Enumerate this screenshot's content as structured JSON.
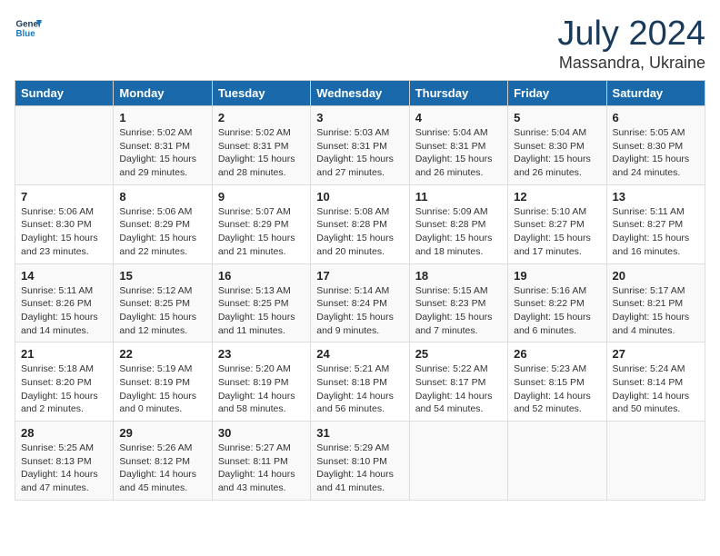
{
  "logo": {
    "line1": "General",
    "line2": "Blue"
  },
  "title": "July 2024",
  "location": "Massandra, Ukraine",
  "days_of_week": [
    "Sunday",
    "Monday",
    "Tuesday",
    "Wednesday",
    "Thursday",
    "Friday",
    "Saturday"
  ],
  "weeks": [
    [
      {
        "num": "",
        "info": ""
      },
      {
        "num": "1",
        "info": "Sunrise: 5:02 AM\nSunset: 8:31 PM\nDaylight: 15 hours\nand 29 minutes."
      },
      {
        "num": "2",
        "info": "Sunrise: 5:02 AM\nSunset: 8:31 PM\nDaylight: 15 hours\nand 28 minutes."
      },
      {
        "num": "3",
        "info": "Sunrise: 5:03 AM\nSunset: 8:31 PM\nDaylight: 15 hours\nand 27 minutes."
      },
      {
        "num": "4",
        "info": "Sunrise: 5:04 AM\nSunset: 8:31 PM\nDaylight: 15 hours\nand 26 minutes."
      },
      {
        "num": "5",
        "info": "Sunrise: 5:04 AM\nSunset: 8:30 PM\nDaylight: 15 hours\nand 26 minutes."
      },
      {
        "num": "6",
        "info": "Sunrise: 5:05 AM\nSunset: 8:30 PM\nDaylight: 15 hours\nand 24 minutes."
      }
    ],
    [
      {
        "num": "7",
        "info": "Sunrise: 5:06 AM\nSunset: 8:30 PM\nDaylight: 15 hours\nand 23 minutes."
      },
      {
        "num": "8",
        "info": "Sunrise: 5:06 AM\nSunset: 8:29 PM\nDaylight: 15 hours\nand 22 minutes."
      },
      {
        "num": "9",
        "info": "Sunrise: 5:07 AM\nSunset: 8:29 PM\nDaylight: 15 hours\nand 21 minutes."
      },
      {
        "num": "10",
        "info": "Sunrise: 5:08 AM\nSunset: 8:28 PM\nDaylight: 15 hours\nand 20 minutes."
      },
      {
        "num": "11",
        "info": "Sunrise: 5:09 AM\nSunset: 8:28 PM\nDaylight: 15 hours\nand 18 minutes."
      },
      {
        "num": "12",
        "info": "Sunrise: 5:10 AM\nSunset: 8:27 PM\nDaylight: 15 hours\nand 17 minutes."
      },
      {
        "num": "13",
        "info": "Sunrise: 5:11 AM\nSunset: 8:27 PM\nDaylight: 15 hours\nand 16 minutes."
      }
    ],
    [
      {
        "num": "14",
        "info": "Sunrise: 5:11 AM\nSunset: 8:26 PM\nDaylight: 15 hours\nand 14 minutes."
      },
      {
        "num": "15",
        "info": "Sunrise: 5:12 AM\nSunset: 8:25 PM\nDaylight: 15 hours\nand 12 minutes."
      },
      {
        "num": "16",
        "info": "Sunrise: 5:13 AM\nSunset: 8:25 PM\nDaylight: 15 hours\nand 11 minutes."
      },
      {
        "num": "17",
        "info": "Sunrise: 5:14 AM\nSunset: 8:24 PM\nDaylight: 15 hours\nand 9 minutes."
      },
      {
        "num": "18",
        "info": "Sunrise: 5:15 AM\nSunset: 8:23 PM\nDaylight: 15 hours\nand 7 minutes."
      },
      {
        "num": "19",
        "info": "Sunrise: 5:16 AM\nSunset: 8:22 PM\nDaylight: 15 hours\nand 6 minutes."
      },
      {
        "num": "20",
        "info": "Sunrise: 5:17 AM\nSunset: 8:21 PM\nDaylight: 15 hours\nand 4 minutes."
      }
    ],
    [
      {
        "num": "21",
        "info": "Sunrise: 5:18 AM\nSunset: 8:20 PM\nDaylight: 15 hours\nand 2 minutes."
      },
      {
        "num": "22",
        "info": "Sunrise: 5:19 AM\nSunset: 8:19 PM\nDaylight: 15 hours\nand 0 minutes."
      },
      {
        "num": "23",
        "info": "Sunrise: 5:20 AM\nSunset: 8:19 PM\nDaylight: 14 hours\nand 58 minutes."
      },
      {
        "num": "24",
        "info": "Sunrise: 5:21 AM\nSunset: 8:18 PM\nDaylight: 14 hours\nand 56 minutes."
      },
      {
        "num": "25",
        "info": "Sunrise: 5:22 AM\nSunset: 8:17 PM\nDaylight: 14 hours\nand 54 minutes."
      },
      {
        "num": "26",
        "info": "Sunrise: 5:23 AM\nSunset: 8:15 PM\nDaylight: 14 hours\nand 52 minutes."
      },
      {
        "num": "27",
        "info": "Sunrise: 5:24 AM\nSunset: 8:14 PM\nDaylight: 14 hours\nand 50 minutes."
      }
    ],
    [
      {
        "num": "28",
        "info": "Sunrise: 5:25 AM\nSunset: 8:13 PM\nDaylight: 14 hours\nand 47 minutes."
      },
      {
        "num": "29",
        "info": "Sunrise: 5:26 AM\nSunset: 8:12 PM\nDaylight: 14 hours\nand 45 minutes."
      },
      {
        "num": "30",
        "info": "Sunrise: 5:27 AM\nSunset: 8:11 PM\nDaylight: 14 hours\nand 43 minutes."
      },
      {
        "num": "31",
        "info": "Sunrise: 5:29 AM\nSunset: 8:10 PM\nDaylight: 14 hours\nand 41 minutes."
      },
      {
        "num": "",
        "info": ""
      },
      {
        "num": "",
        "info": ""
      },
      {
        "num": "",
        "info": ""
      }
    ]
  ]
}
